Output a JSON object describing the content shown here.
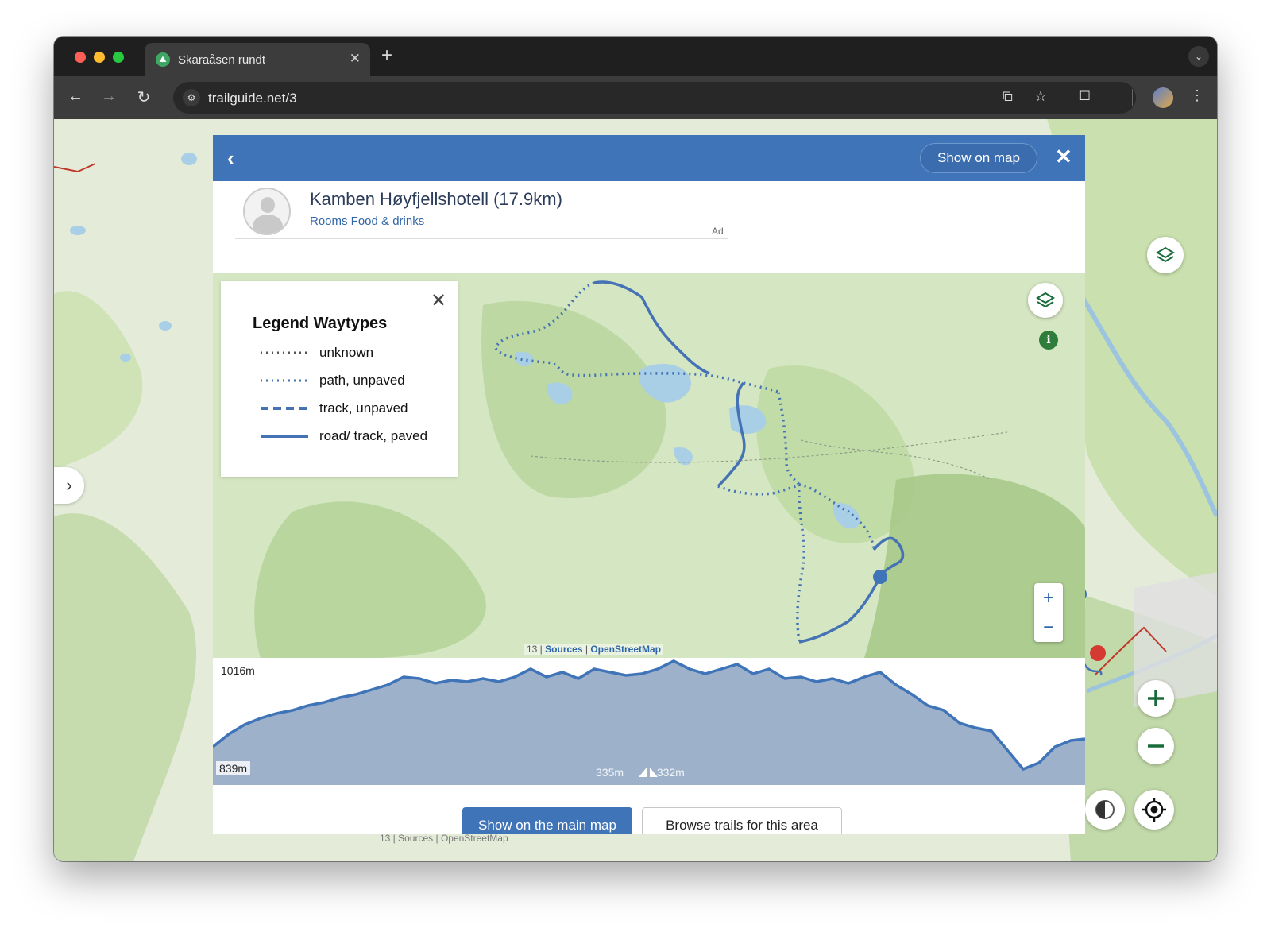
{
  "browser": {
    "tab_title": "Skaraåsen rundt",
    "tab_close": "✕",
    "new_tab": "+",
    "url": "trailguide.net/3"
  },
  "modal": {
    "show_on_map": "Show on map",
    "ad": {
      "title": "Kamben Høyfjellshotell (17.9km)",
      "subtitle": "Rooms Food & drinks",
      "label": "Ad"
    },
    "legend": {
      "title": "Legend Waytypes",
      "items": [
        {
          "label": "unknown",
          "style": "dotted-gray"
        },
        {
          "label": "path, unpaved",
          "style": "dotted-blue"
        },
        {
          "label": "track, unpaved",
          "style": "dashed-blue"
        },
        {
          "label": "road/ track, paved",
          "style": "solid-blue"
        }
      ]
    },
    "map_attribution": {
      "zoom": "13 |",
      "sources": "Sources",
      "sep": "|",
      "osm": "OpenStreetMap"
    },
    "elevation": {
      "max": "1016m",
      "min": "839m",
      "ascent": "335m",
      "descent": "332m"
    },
    "buttons": {
      "main_map": "Show on the main map",
      "browse": "Browse trails for this area"
    }
  },
  "background": {
    "attribution": "13 | Sources | OpenStreetMap"
  },
  "colors": {
    "header_blue": "#3f74b8",
    "trail_blue": "#4472b4",
    "map_green": "#c9e0ae",
    "water": "#a9cfe6"
  }
}
